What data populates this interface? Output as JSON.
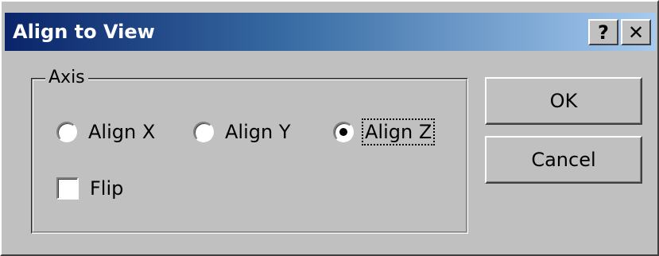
{
  "window": {
    "title": "Align to View",
    "help_glyph": "?",
    "close_glyph": "✕"
  },
  "axis_group": {
    "legend": "Axis",
    "options": [
      {
        "label": "Align X",
        "selected": false
      },
      {
        "label": "Align Y",
        "selected": false
      },
      {
        "label": "Align Z",
        "selected": true
      }
    ],
    "flip": {
      "label": "Flip",
      "checked": false
    }
  },
  "buttons": {
    "ok_label": "OK",
    "cancel_label": "Cancel"
  },
  "colors": {
    "face": "#c0c0c0",
    "title_start": "#0a246a",
    "title_end": "#a6caf0"
  }
}
